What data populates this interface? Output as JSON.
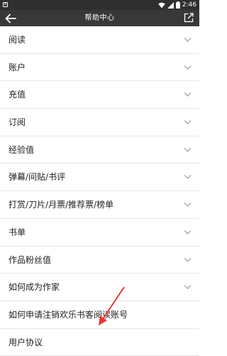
{
  "status_bar": {
    "left_icon": "A",
    "time": "2:46",
    "icons": [
      "wifi-icon",
      "signal-icon",
      "battery-icon"
    ]
  },
  "toolbar": {
    "title": "帮助中心",
    "back_icon": "back-arrow-icon",
    "share_icon": "share-icon"
  },
  "items": [
    {
      "label": "阅读",
      "expandable": true
    },
    {
      "label": "账户",
      "expandable": true
    },
    {
      "label": "充值",
      "expandable": true
    },
    {
      "label": "订阅",
      "expandable": true
    },
    {
      "label": "经验值",
      "expandable": true
    },
    {
      "label": "弹幕/间贴/书评",
      "expandable": true
    },
    {
      "label": "打赏/刀片/月票/推荐票/榜单",
      "expandable": true
    },
    {
      "label": "书单",
      "expandable": true
    },
    {
      "label": "作品粉丝值",
      "expandable": true
    },
    {
      "label": "如何成为作家",
      "expandable": true
    },
    {
      "label": "如何申请注销欢乐书客阅读账号",
      "expandable": false
    },
    {
      "label": "用户协议",
      "expandable": false
    }
  ],
  "colors": {
    "status_bar": "#2f2f2f",
    "toolbar": "#383838",
    "divider": "#e6e6e6",
    "chevron": "#9a9a9a",
    "annotation_arrow": "#e53935"
  }
}
